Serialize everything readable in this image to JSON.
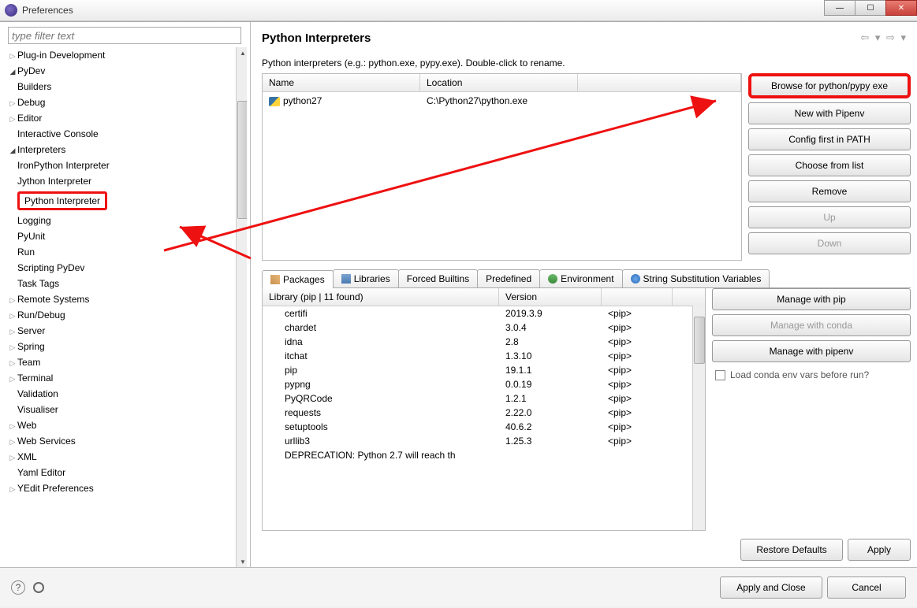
{
  "window": {
    "title": "Preferences"
  },
  "filter": {
    "placeholder": "type filter text"
  },
  "tree": {
    "items": [
      {
        "label": "Plug-in Development",
        "indent": 1,
        "arrow": "▷"
      },
      {
        "label": "PyDev",
        "indent": 1,
        "arrow": "◢"
      },
      {
        "label": "Builders",
        "indent": 2,
        "arrow": ""
      },
      {
        "label": "Debug",
        "indent": 2,
        "arrow": "▷"
      },
      {
        "label": "Editor",
        "indent": 2,
        "arrow": "▷"
      },
      {
        "label": "Interactive Console",
        "indent": 2,
        "arrow": ""
      },
      {
        "label": "Interpreters",
        "indent": 2,
        "arrow": "◢"
      },
      {
        "label": "IronPython Interpreter",
        "indent": 3,
        "arrow": ""
      },
      {
        "label": "Jython Interpreter",
        "indent": 3,
        "arrow": ""
      },
      {
        "label": "Python Interpreter",
        "indent": 3,
        "arrow": "",
        "hl": true
      },
      {
        "label": "Logging",
        "indent": 2,
        "arrow": ""
      },
      {
        "label": "PyUnit",
        "indent": 2,
        "arrow": ""
      },
      {
        "label": "Run",
        "indent": 2,
        "arrow": ""
      },
      {
        "label": "Scripting PyDev",
        "indent": 2,
        "arrow": ""
      },
      {
        "label": "Task Tags",
        "indent": 2,
        "arrow": ""
      },
      {
        "label": "Remote Systems",
        "indent": 1,
        "arrow": "▷"
      },
      {
        "label": "Run/Debug",
        "indent": 1,
        "arrow": "▷"
      },
      {
        "label": "Server",
        "indent": 1,
        "arrow": "▷"
      },
      {
        "label": "Spring",
        "indent": 1,
        "arrow": "▷"
      },
      {
        "label": "Team",
        "indent": 1,
        "arrow": "▷"
      },
      {
        "label": "Terminal",
        "indent": 1,
        "arrow": "▷"
      },
      {
        "label": "Validation",
        "indent": 1,
        "arrow": ""
      },
      {
        "label": "Visualiser",
        "indent": 1,
        "arrow": ""
      },
      {
        "label": "Web",
        "indent": 1,
        "arrow": "▷"
      },
      {
        "label": "Web Services",
        "indent": 1,
        "arrow": "▷"
      },
      {
        "label": "XML",
        "indent": 1,
        "arrow": "▷"
      },
      {
        "label": "Yaml Editor",
        "indent": 1,
        "arrow": ""
      },
      {
        "label": "YEdit Preferences",
        "indent": 1,
        "arrow": "▷"
      }
    ]
  },
  "page": {
    "heading": "Python Interpreters",
    "subtitle": "Python interpreters (e.g.: python.exe, pypy.exe).   Double-click to rename.",
    "navarrows": "⇦ ▾ ⇨ ▾"
  },
  "interpreters": {
    "headers": {
      "name": "Name",
      "location": "Location"
    },
    "rows": [
      {
        "name": "python27",
        "location": "C:\\Python27\\python.exe"
      }
    ]
  },
  "sidebuttons": {
    "browse": "Browse for python/pypy exe",
    "newpipenv": "New with Pipenv",
    "configpath": "Config first in PATH",
    "choose": "Choose from list",
    "remove": "Remove",
    "up": "Up",
    "down": "Down"
  },
  "tabs": {
    "packages": "Packages",
    "libraries": "Libraries",
    "forced": "Forced Builtins",
    "predefined": "Predefined",
    "environment": "Environment",
    "stringsub": "String Substitution Variables"
  },
  "packages": {
    "headers": {
      "library": "Library (pip | 11 found)",
      "version": "Version",
      "blank": ""
    },
    "rows": [
      {
        "lib": "certifi",
        "ver": "2019.3.9",
        "src": "<pip>"
      },
      {
        "lib": "chardet",
        "ver": "3.0.4",
        "src": "<pip>"
      },
      {
        "lib": "idna",
        "ver": "2.8",
        "src": "<pip>"
      },
      {
        "lib": "itchat",
        "ver": "1.3.10",
        "src": "<pip>"
      },
      {
        "lib": "pip",
        "ver": "19.1.1",
        "src": "<pip>"
      },
      {
        "lib": "pypng",
        "ver": "0.0.19",
        "src": "<pip>"
      },
      {
        "lib": "PyQRCode",
        "ver": "1.2.1",
        "src": "<pip>"
      },
      {
        "lib": "requests",
        "ver": "2.22.0",
        "src": "<pip>"
      },
      {
        "lib": "setuptools",
        "ver": "40.6.2",
        "src": "<pip>"
      },
      {
        "lib": "urllib3",
        "ver": "1.25.3",
        "src": "<pip>"
      }
    ],
    "deprecation": "DEPRECATION: Python 2.7 will reach th"
  },
  "pkgbuttons": {
    "pip": "Manage with pip",
    "conda": "Manage with conda",
    "pipenv": "Manage with pipenv",
    "loadconda": "Load conda env vars before run?"
  },
  "bottombuttons": {
    "restore": "Restore Defaults",
    "apply": "Apply"
  },
  "footer": {
    "applyclose": "Apply and Close",
    "cancel": "Cancel"
  }
}
